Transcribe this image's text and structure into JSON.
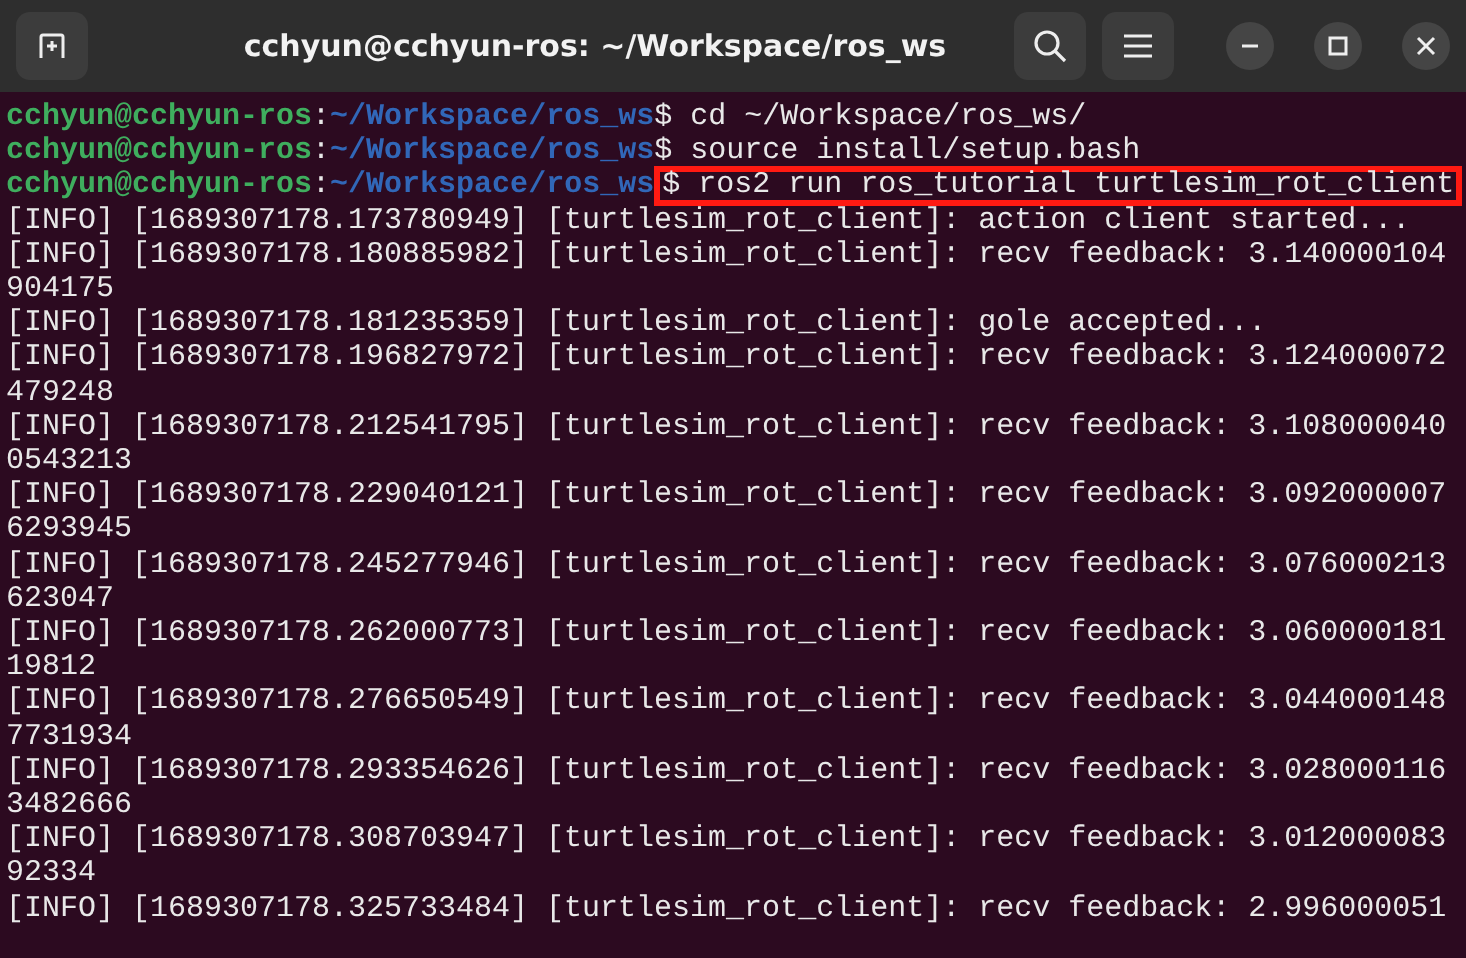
{
  "window": {
    "title": "cchyun@cchyun-ros: ~/Workspace/ros_ws"
  },
  "lines": [
    {
      "kind": "prompt",
      "user_host": "cchyun@cchyun-ros",
      "separator": ":",
      "path": "~/Workspace/ros_ws",
      "command": "$ cd ~/Workspace/ros_ws/",
      "highlighted": false
    },
    {
      "kind": "prompt",
      "user_host": "cchyun@cchyun-ros",
      "separator": ":",
      "path": "~/Workspace/ros_ws",
      "command": "$ source install/setup.bash",
      "highlighted": false
    },
    {
      "kind": "prompt",
      "user_host": "cchyun@cchyun-ros",
      "separator": ":",
      "path": "~/Workspace/ros_ws",
      "command": "$ ros2 run ros_tutorial turtlesim_rot_client",
      "highlighted": true
    },
    {
      "kind": "output",
      "text": "[INFO] [1689307178.173780949] [turtlesim_rot_client]: action client started..."
    },
    {
      "kind": "output",
      "text": "[INFO] [1689307178.180885982] [turtlesim_rot_client]: recv feedback: 3.140000104904175"
    },
    {
      "kind": "output",
      "text": "[INFO] [1689307178.181235359] [turtlesim_rot_client]: gole accepted..."
    },
    {
      "kind": "output",
      "text": "[INFO] [1689307178.196827972] [turtlesim_rot_client]: recv feedback: 3.124000072479248"
    },
    {
      "kind": "output",
      "text": "[INFO] [1689307178.212541795] [turtlesim_rot_client]: recv feedback: 3.1080000400543213"
    },
    {
      "kind": "output",
      "text": "[INFO] [1689307178.229040121] [turtlesim_rot_client]: recv feedback: 3.0920000076293945"
    },
    {
      "kind": "output",
      "text": "[INFO] [1689307178.245277946] [turtlesim_rot_client]: recv feedback: 3.076000213623047"
    },
    {
      "kind": "output",
      "text": "[INFO] [1689307178.262000773] [turtlesim_rot_client]: recv feedback: 3.06000018119812"
    },
    {
      "kind": "output",
      "text": "[INFO] [1689307178.276650549] [turtlesim_rot_client]: recv feedback: 3.0440001487731934"
    },
    {
      "kind": "output",
      "text": "[INFO] [1689307178.293354626] [turtlesim_rot_client]: recv feedback: 3.0280001163482666"
    },
    {
      "kind": "output",
      "text": "[INFO] [1689307178.308703947] [turtlesim_rot_client]: recv feedback: 3.01200008392334"
    },
    {
      "kind": "output",
      "text": "[INFO] [1689307178.325733484] [turtlesim_rot_client]: recv feedback: 2.996000051"
    }
  ]
}
